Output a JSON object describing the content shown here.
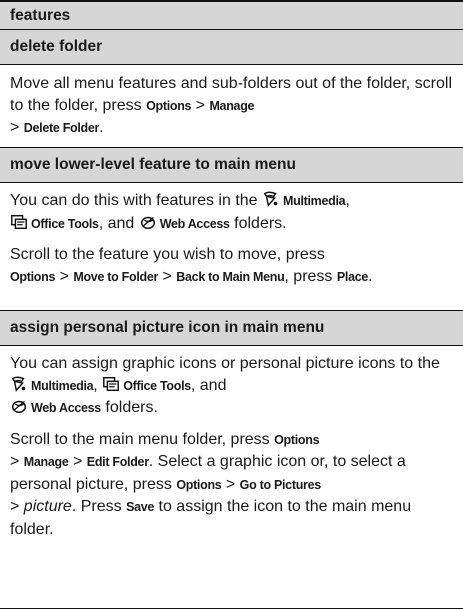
{
  "table_header": "features",
  "sections": [
    {
      "title": "delete folder",
      "p1": {
        "t1": "Move all menu features and sub-folders out of the folder, scroll to the folder, press ",
        "k1": "Options",
        "s1": " > ",
        "k2": "Manage",
        "s2": " > ",
        "k3": "Delete Folder",
        "end": "."
      }
    },
    {
      "title": "move lower-level feature to main menu",
      "p1": {
        "t1": "You can do this with features in the ",
        "k1": "Multimedia",
        "s1": ", ",
        "k2": "Office Tools",
        "s2": ", and ",
        "k3": "Web Access",
        "end": " folders."
      },
      "p2": {
        "t1": "Scroll to the feature you wish to move, press ",
        "k1": "Options",
        "s1": " > ",
        "k2": "Move to Folder",
        "s2": " > ",
        "k3": "Back to Main Menu",
        "s3": ", press ",
        "k4": "Place",
        "end": "."
      }
    },
    {
      "title": "assign personal picture icon in main menu",
      "p1": {
        "t1": "You can assign graphic icons or personal picture icons to the ",
        "k1": "Multimedia",
        "s1": ", ",
        "k2": "Office Tools",
        "s2": ", and ",
        "k3": "Web Access",
        "end": " folders."
      },
      "p2": {
        "t1": "Scroll to the main menu folder, press ",
        "k1": "Options",
        "s1": " > ",
        "k2": "Manage",
        "s2": " > ",
        "k3": "Edit Folder",
        "t2": ". Select a graphic icon or, to select a personal picture, press ",
        "k4": "Options",
        "s3": " > ",
        "k5": "Go to Pictures",
        "s4": " > ",
        "i1": "picture",
        "t3": ". Press ",
        "k6": "Save",
        "end": " to assign the icon to the main menu folder."
      }
    }
  ],
  "icons": {
    "multimedia": "multimedia-icon",
    "office_tools": "office-tools-icon",
    "web_access": "web-access-icon"
  }
}
